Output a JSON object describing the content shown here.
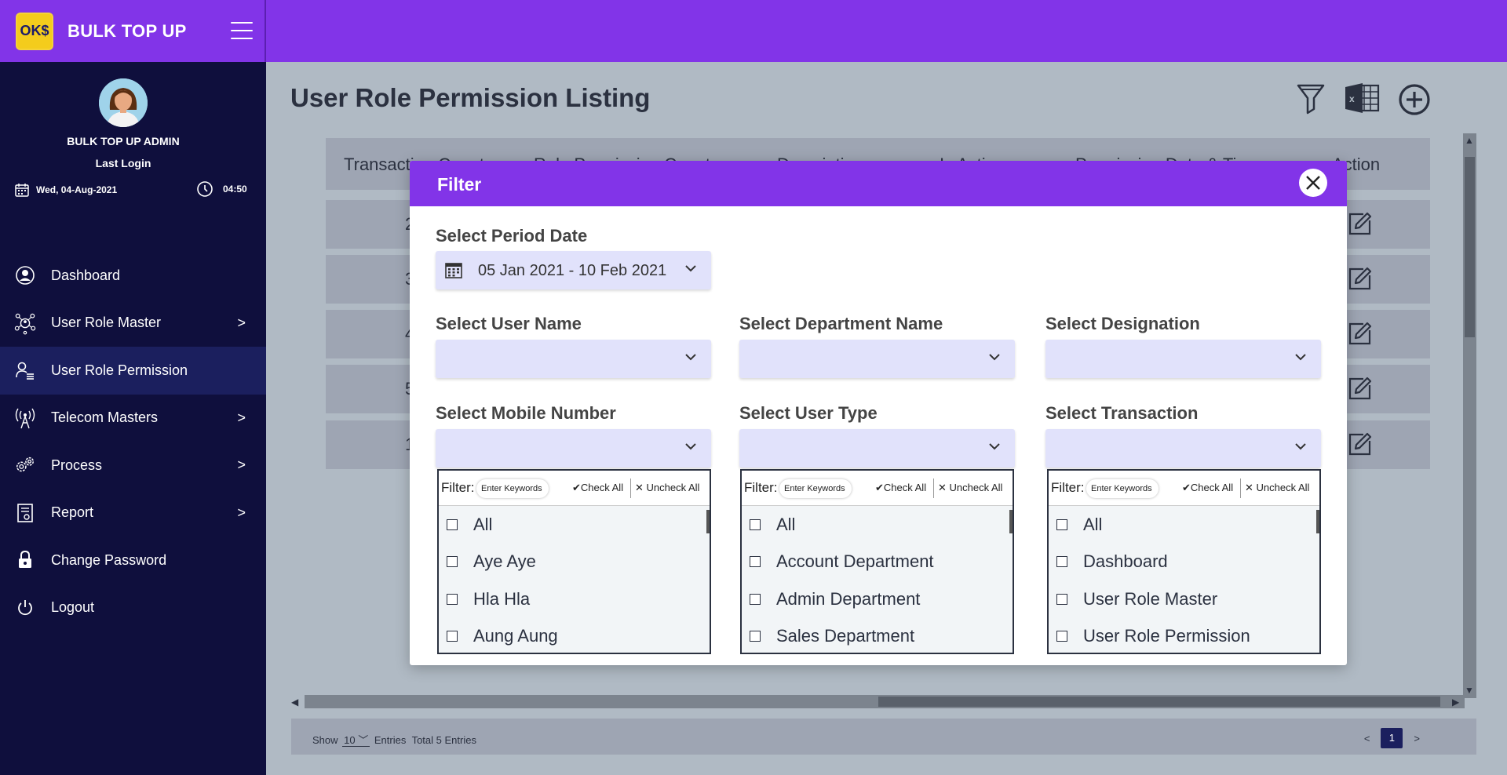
{
  "brand": {
    "logo_text": "OK$",
    "name": "BULK TOP UP"
  },
  "user": {
    "name": "BULK TOP UP ADMIN",
    "last_login_label": "Last Login",
    "date": "Wed, 04-Aug-2021",
    "time": "04:50"
  },
  "sidebar": {
    "items": [
      {
        "label": "Dashboard",
        "icon": "user-circle-icon",
        "has_submenu": false,
        "active": false
      },
      {
        "label": "User Role Master",
        "icon": "user-network-icon",
        "has_submenu": true,
        "active": false
      },
      {
        "label": "User Role Permission",
        "icon": "user-list-icon",
        "has_submenu": false,
        "active": true
      },
      {
        "label": "Telecom Masters",
        "icon": "antenna-icon",
        "has_submenu": true,
        "active": false
      },
      {
        "label": "Process",
        "icon": "gears-icon",
        "has_submenu": true,
        "active": false
      },
      {
        "label": "Report",
        "icon": "report-icon",
        "has_submenu": true,
        "active": false
      },
      {
        "label": "Change Password",
        "icon": "lock-icon",
        "has_submenu": false,
        "active": false
      },
      {
        "label": "Logout",
        "icon": "power-icon",
        "has_submenu": false,
        "active": false
      }
    ],
    "chevron": ">"
  },
  "page": {
    "title": "User Role Permission Listing"
  },
  "table": {
    "headers": [
      "Transaction Count",
      "Role Permission Count",
      "Description",
      "Is Active",
      "Permission Date & Time",
      "Action"
    ],
    "rows": [
      {
        "number": "2"
      },
      {
        "number": "3"
      },
      {
        "number": "4"
      },
      {
        "number": "5"
      },
      {
        "number": "1"
      }
    ]
  },
  "footer": {
    "show_label": "Show",
    "page_size": "10",
    "entries_label": "Entries",
    "total": "Total 5 Entries",
    "prev": "<",
    "page": "1",
    "next": ">"
  },
  "modal": {
    "title": "Filter",
    "period_label": "Select Period Date",
    "period_value": "05 Jan 2021 - 10 Feb 2021",
    "fields": {
      "user_name": "Select User Name",
      "department": "Select Department Name",
      "designation": "Select Designation",
      "mobile": "Select Mobile Number",
      "user_type": "Select User Type",
      "transaction": "Select Transaction"
    },
    "list_filter": {
      "label": "Filter:",
      "placeholder": "Enter Keywords",
      "check_all": "✔Check All",
      "uncheck_all": "✕ Uncheck All"
    },
    "lists": {
      "mobile": [
        "All",
        "Aye Aye",
        "Hla Hla",
        "Aung Aung"
      ],
      "user_type": [
        "All",
        "Account Department",
        "Admin Department",
        "Sales Department"
      ],
      "transaction": [
        "All",
        "Dashboard",
        "User Role Master",
        "User Role Permission"
      ]
    }
  },
  "colors": {
    "primary": "#8234e8",
    "sidebar": "#0f0f3d",
    "sidebar_active": "#1b1f5e",
    "select_bg": "#e1e2fb",
    "overlay": "#b0bac4"
  }
}
